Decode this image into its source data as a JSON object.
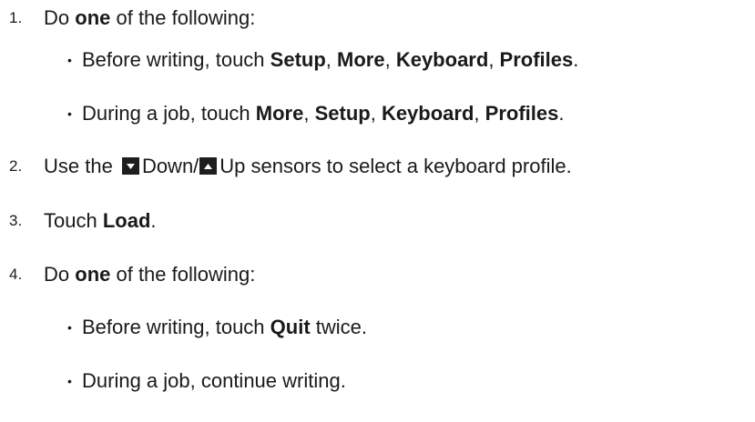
{
  "steps": [
    {
      "number": "1.",
      "text": {
        "a": "Do ",
        "b": "one",
        "c": " of the following:"
      },
      "bullets": [
        {
          "a": "Before writing, touch ",
          "b1": "Setup",
          "s1": ", ",
          "b2": "More",
          "s2": ", ",
          "b3": "Keyboard",
          "s3": ", ",
          "b4": "Profiles",
          "end": "."
        },
        {
          "a": "During a job, touch ",
          "b1": "More",
          "s1": ", ",
          "b2": "Setup",
          "s2": ", ",
          "b3": "Keyboard",
          "s3": ", ",
          "b4": "Profiles",
          "end": "."
        }
      ]
    },
    {
      "number": "2.",
      "text": {
        "a": "Use the ",
        "down": "Down/",
        "up": "Up sensors to select a keyboard profile."
      }
    },
    {
      "number": "3.",
      "text": {
        "a": "Touch ",
        "b": "Load",
        "c": "."
      }
    },
    {
      "number": "4.",
      "text": {
        "a": "Do ",
        "b": "one",
        "c": " of the following:"
      },
      "bullets": [
        {
          "a": "Before writing, touch ",
          "b": "Quit",
          "c": " twice."
        },
        {
          "a": "During a job, continue writing."
        }
      ]
    }
  ],
  "bullet_glyph": "•",
  "icons": {
    "down": "down-arrow-icon",
    "up": "up-arrow-icon"
  },
  "colors": {
    "text": "#1a1a1a",
    "icon_bg": "#1e1e1e",
    "icon_glyph": "#ffffff"
  }
}
